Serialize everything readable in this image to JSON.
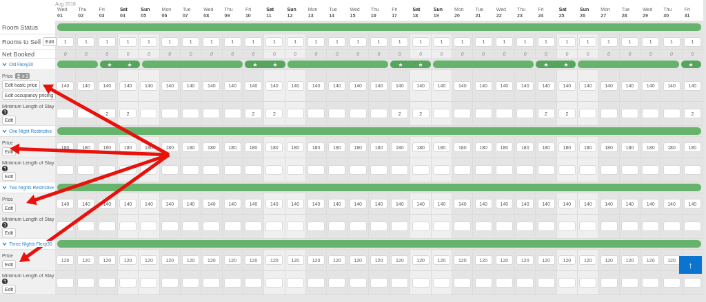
{
  "month": "Aug 2018",
  "days": [
    {
      "dow": "Wed",
      "date": "01",
      "weekend": false
    },
    {
      "dow": "Thu",
      "date": "02",
      "weekend": false
    },
    {
      "dow": "Fri",
      "date": "03",
      "weekend": false
    },
    {
      "dow": "Sat",
      "date": "04",
      "weekend": true
    },
    {
      "dow": "Sun",
      "date": "05",
      "weekend": true
    },
    {
      "dow": "Mon",
      "date": "06",
      "weekend": false
    },
    {
      "dow": "Tue",
      "date": "07",
      "weekend": false
    },
    {
      "dow": "Wed",
      "date": "08",
      "weekend": false
    },
    {
      "dow": "Thu",
      "date": "09",
      "weekend": false
    },
    {
      "dow": "Fri",
      "date": "10",
      "weekend": false
    },
    {
      "dow": "Sat",
      "date": "11",
      "weekend": true
    },
    {
      "dow": "Sun",
      "date": "12",
      "weekend": true
    },
    {
      "dow": "Mon",
      "date": "13",
      "weekend": false
    },
    {
      "dow": "Tue",
      "date": "14",
      "weekend": false
    },
    {
      "dow": "Wed",
      "date": "15",
      "weekend": false
    },
    {
      "dow": "Thu",
      "date": "16",
      "weekend": false
    },
    {
      "dow": "Fri",
      "date": "17",
      "weekend": false
    },
    {
      "dow": "Sat",
      "date": "18",
      "weekend": true
    },
    {
      "dow": "Sun",
      "date": "19",
      "weekend": true
    },
    {
      "dow": "Mon",
      "date": "20",
      "weekend": false
    },
    {
      "dow": "Tue",
      "date": "21",
      "weekend": false
    },
    {
      "dow": "Wed",
      "date": "22",
      "weekend": false
    },
    {
      "dow": "Thu",
      "date": "23",
      "weekend": false
    },
    {
      "dow": "Fri",
      "date": "24",
      "weekend": false
    },
    {
      "dow": "Sat",
      "date": "25",
      "weekend": true
    },
    {
      "dow": "Sun",
      "date": "26",
      "weekend": true
    },
    {
      "dow": "Mon",
      "date": "27",
      "weekend": false
    },
    {
      "dow": "Tue",
      "date": "28",
      "weekend": false
    },
    {
      "dow": "Wed",
      "date": "29",
      "weekend": false
    },
    {
      "dow": "Thu",
      "date": "30",
      "weekend": false
    },
    {
      "dow": "Fri",
      "date": "31",
      "weekend": false
    }
  ],
  "room_status": {
    "label": "Room Status"
  },
  "rooms_to_sell": {
    "label": "Rooms to Sell",
    "button": "Edit",
    "values": [
      "1",
      "1",
      "1",
      "1",
      "1",
      "1",
      "1",
      "1",
      "1",
      "1",
      "1",
      "1",
      "1",
      "1",
      "1",
      "1",
      "1",
      "1",
      "1",
      "1",
      "1",
      "1",
      "1",
      "1",
      "1",
      "1",
      "1",
      "1",
      "1",
      "1",
      "1"
    ]
  },
  "net_booked": {
    "label": "Net Booked",
    "values": [
      "0",
      "0",
      "0",
      "0",
      "0",
      "0",
      "0",
      "0",
      "0",
      "0",
      "0",
      "0",
      "0",
      "0",
      "0",
      "0",
      "0",
      "0",
      "0",
      "0",
      "0",
      "0",
      "0",
      "0",
      "0",
      "0",
      "0",
      "0",
      "0",
      "0",
      "0"
    ]
  },
  "rate_plans": [
    {
      "name": "Old Flexy30",
      "expanded": true,
      "restricted": [
        false,
        false,
        true,
        true,
        false,
        false,
        false,
        false,
        false,
        true,
        true,
        false,
        false,
        false,
        false,
        false,
        true,
        true,
        false,
        false,
        false,
        false,
        false,
        true,
        true,
        false,
        false,
        false,
        false,
        false,
        true
      ],
      "rows": [
        {
          "kind": "price",
          "label": "Price",
          "occupancy": "x 2",
          "buttons": [
            "Edit basic price",
            "Edit occupancy pricing"
          ],
          "cells": [
            {
              "value": "140"
            },
            {
              "value": "140"
            },
            {
              "value": "140"
            },
            {
              "value": "140"
            },
            {
              "value": "140"
            },
            {
              "value": "140"
            },
            {
              "value": "140"
            },
            {
              "value": "140"
            },
            {
              "value": "140"
            },
            {
              "value": "140"
            },
            {
              "value": "140"
            },
            {
              "value": "140"
            },
            {
              "value": "140"
            },
            {
              "value": "140"
            },
            {
              "value": "140"
            },
            {
              "value": "140"
            },
            {
              "value": "140"
            },
            {
              "value": "140"
            },
            {
              "value": "140"
            },
            {
              "value": "140"
            },
            {
              "value": "140"
            },
            {
              "value": "140"
            },
            {
              "value": "140"
            },
            {
              "value": "140"
            },
            {
              "value": "140"
            },
            {
              "value": "140"
            },
            {
              "value": "140"
            },
            {
              "value": "140"
            },
            {
              "value": "140"
            },
            {
              "value": "140"
            },
            {
              "value": "140"
            }
          ]
        },
        {
          "kind": "min_stay",
          "label": "Minimum Length of Stay",
          "buttons": [
            "Edit"
          ],
          "cells": [
            {
              "empty": true
            },
            {
              "empty": true
            },
            {
              "value": "2"
            },
            {
              "value": "2"
            },
            {
              "empty": true
            },
            {
              "empty": true
            },
            {
              "empty": true
            },
            {
              "empty": true
            },
            {
              "empty": true
            },
            {
              "value": "2"
            },
            {
              "value": "2"
            },
            {
              "empty": true
            },
            {
              "empty": true
            },
            {
              "empty": true
            },
            {
              "empty": true
            },
            {
              "empty": true
            },
            {
              "value": "2"
            },
            {
              "value": "2"
            },
            {
              "empty": true
            },
            {
              "empty": true
            },
            {
              "empty": true
            },
            {
              "empty": true
            },
            {
              "empty": true
            },
            {
              "value": "2"
            },
            {
              "value": "2"
            },
            {
              "empty": true
            },
            {
              "empty": true
            },
            {
              "empty": true
            },
            {
              "empty": true
            },
            {
              "empty": true
            },
            {
              "value": "2"
            }
          ]
        }
      ]
    },
    {
      "name": "One Night Restrictive",
      "expanded": true,
      "restricted": [
        false,
        false,
        false,
        false,
        false,
        false,
        false,
        false,
        false,
        false,
        false,
        false,
        false,
        false,
        false,
        false,
        false,
        false,
        false,
        false,
        false,
        false,
        false,
        false,
        false,
        false,
        false,
        false,
        false,
        false,
        false
      ],
      "rows": [
        {
          "kind": "price",
          "label": "Price",
          "buttons": [
            "Edit"
          ],
          "cells": [
            {
              "value": "180"
            },
            {
              "value": "180"
            },
            {
              "value": "180"
            },
            {
              "value": "180"
            },
            {
              "value": "180"
            },
            {
              "value": "180"
            },
            {
              "value": "180"
            },
            {
              "value": "180"
            },
            {
              "value": "180"
            },
            {
              "value": "180"
            },
            {
              "value": "180"
            },
            {
              "value": "180"
            },
            {
              "value": "180"
            },
            {
              "value": "180"
            },
            {
              "value": "180"
            },
            {
              "value": "180"
            },
            {
              "value": "180"
            },
            {
              "value": "180"
            },
            {
              "value": "180"
            },
            {
              "value": "180"
            },
            {
              "value": "180"
            },
            {
              "value": "180"
            },
            {
              "value": "180"
            },
            {
              "value": "180"
            },
            {
              "value": "180"
            },
            {
              "value": "180"
            },
            {
              "value": "180"
            },
            {
              "value": "180"
            },
            {
              "value": "180"
            },
            {
              "value": "180"
            },
            {
              "value": "180"
            }
          ]
        },
        {
          "kind": "min_stay",
          "label": "Minimum Length of Stay",
          "buttons": [
            "Edit"
          ],
          "cells": [
            {
              "empty": true
            },
            {
              "empty": true
            },
            {
              "empty": true
            },
            {
              "empty": true
            },
            {
              "empty": true
            },
            {
              "empty": true
            },
            {
              "empty": true
            },
            {
              "empty": true
            },
            {
              "empty": true
            },
            {
              "empty": true
            },
            {
              "empty": true
            },
            {
              "empty": true
            },
            {
              "empty": true
            },
            {
              "empty": true
            },
            {
              "empty": true
            },
            {
              "empty": true
            },
            {
              "empty": true
            },
            {
              "empty": true
            },
            {
              "empty": true
            },
            {
              "empty": true
            },
            {
              "empty": true
            },
            {
              "empty": true
            },
            {
              "empty": true
            },
            {
              "empty": true
            },
            {
              "empty": true
            },
            {
              "empty": true
            },
            {
              "empty": true
            },
            {
              "empty": true
            },
            {
              "empty": true
            },
            {
              "empty": true
            },
            {
              "empty": true
            }
          ]
        }
      ]
    },
    {
      "name": "Two Nights Restrictive",
      "expanded": true,
      "restricted": [
        false,
        false,
        false,
        false,
        false,
        false,
        false,
        false,
        false,
        false,
        false,
        false,
        false,
        false,
        false,
        false,
        false,
        false,
        false,
        false,
        false,
        false,
        false,
        false,
        false,
        false,
        false,
        false,
        false,
        false,
        false
      ],
      "rows": [
        {
          "kind": "price",
          "label": "Price",
          "buttons": [
            "Edit"
          ],
          "cells": [
            {
              "value": "140"
            },
            {
              "value": "140"
            },
            {
              "value": "140"
            },
            {
              "value": "140"
            },
            {
              "value": "140"
            },
            {
              "value": "140"
            },
            {
              "value": "140"
            },
            {
              "value": "140"
            },
            {
              "value": "140"
            },
            {
              "value": "140"
            },
            {
              "value": "140"
            },
            {
              "value": "140"
            },
            {
              "value": "140"
            },
            {
              "value": "140"
            },
            {
              "value": "140"
            },
            {
              "value": "140"
            },
            {
              "value": "140"
            },
            {
              "value": "140"
            },
            {
              "value": "140"
            },
            {
              "value": "140"
            },
            {
              "value": "140"
            },
            {
              "value": "140"
            },
            {
              "value": "140"
            },
            {
              "value": "140"
            },
            {
              "value": "140"
            },
            {
              "value": "140"
            },
            {
              "value": "140"
            },
            {
              "value": "140"
            },
            {
              "value": "140"
            },
            {
              "value": "140"
            },
            {
              "value": "140"
            }
          ]
        },
        {
          "kind": "min_stay",
          "label": "Minimum Length of Stay",
          "buttons": [
            "Edit"
          ],
          "cells": [
            {
              "empty": true
            },
            {
              "empty": true
            },
            {
              "empty": true
            },
            {
              "empty": true
            },
            {
              "empty": true
            },
            {
              "empty": true
            },
            {
              "empty": true
            },
            {
              "empty": true
            },
            {
              "empty": true
            },
            {
              "empty": true
            },
            {
              "empty": true
            },
            {
              "empty": true
            },
            {
              "empty": true
            },
            {
              "empty": true
            },
            {
              "empty": true
            },
            {
              "empty": true
            },
            {
              "empty": true
            },
            {
              "empty": true
            },
            {
              "empty": true
            },
            {
              "empty": true
            },
            {
              "empty": true
            },
            {
              "empty": true
            },
            {
              "empty": true
            },
            {
              "empty": true
            },
            {
              "empty": true
            },
            {
              "empty": true
            },
            {
              "empty": true
            },
            {
              "empty": true
            },
            {
              "empty": true
            },
            {
              "empty": true
            },
            {
              "empty": true
            }
          ]
        }
      ]
    },
    {
      "name": "Three Nights Flexy30",
      "expanded": true,
      "restricted": [
        false,
        false,
        false,
        false,
        false,
        false,
        false,
        false,
        false,
        false,
        false,
        false,
        false,
        false,
        false,
        false,
        false,
        false,
        false,
        false,
        false,
        false,
        false,
        false,
        false,
        false,
        false,
        false,
        false,
        false,
        false
      ],
      "rows": [
        {
          "kind": "price",
          "label": "Price",
          "buttons": [
            "Edit"
          ],
          "cells": [
            {
              "value": "120"
            },
            {
              "value": "120"
            },
            {
              "value": "120"
            },
            {
              "value": "120"
            },
            {
              "value": "120"
            },
            {
              "value": "120"
            },
            {
              "value": "120"
            },
            {
              "value": "120"
            },
            {
              "value": "120"
            },
            {
              "value": "120"
            },
            {
              "value": "120"
            },
            {
              "value": "120"
            },
            {
              "value": "120"
            },
            {
              "value": "120"
            },
            {
              "value": "120"
            },
            {
              "value": "120"
            },
            {
              "value": "120"
            },
            {
              "value": "120"
            },
            {
              "value": "120"
            },
            {
              "value": "120"
            },
            {
              "value": "120"
            },
            {
              "value": "120"
            },
            {
              "value": "120"
            },
            {
              "value": "120"
            },
            {
              "value": "120"
            },
            {
              "value": "120"
            },
            {
              "value": "120"
            },
            {
              "value": "120"
            },
            {
              "value": "120"
            },
            {
              "value": "120"
            }
          ]
        },
        {
          "kind": "min_stay",
          "label": "Minimum Length of Stay",
          "buttons": [
            "Edit"
          ],
          "cells": [
            {
              "empty": true
            },
            {
              "empty": true
            },
            {
              "empty": true
            },
            {
              "empty": true
            },
            {
              "empty": true
            },
            {
              "empty": true
            },
            {
              "empty": true
            },
            {
              "empty": true
            },
            {
              "empty": true
            },
            {
              "empty": true
            },
            {
              "empty": true
            },
            {
              "empty": true
            },
            {
              "empty": true
            },
            {
              "empty": true
            },
            {
              "empty": true
            },
            {
              "empty": true
            },
            {
              "empty": true
            },
            {
              "empty": true
            },
            {
              "empty": true
            },
            {
              "empty": true
            },
            {
              "empty": true
            },
            {
              "empty": true
            },
            {
              "empty": true
            },
            {
              "empty": true
            },
            {
              "empty": true
            },
            {
              "empty": true
            },
            {
              "empty": true
            },
            {
              "empty": true
            },
            {
              "empty": true
            },
            {
              "empty": true
            },
            {
              "empty": true
            }
          ]
        }
      ]
    }
  ],
  "scroll_top": {
    "label": "↑"
  }
}
